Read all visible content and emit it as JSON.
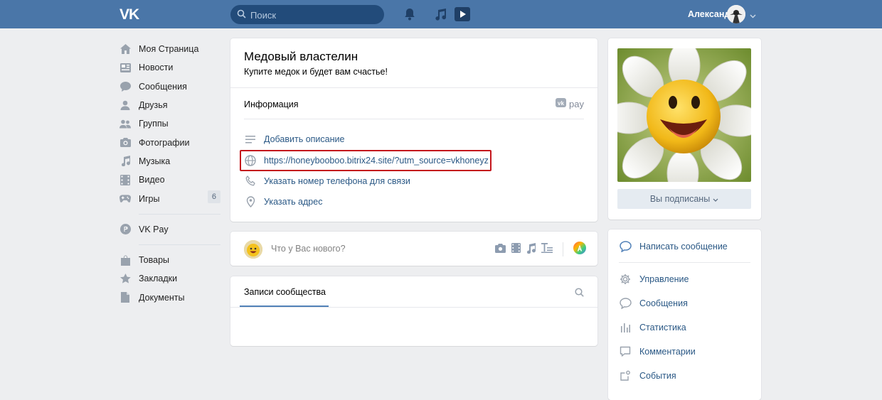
{
  "topbar": {
    "logo": "VK",
    "search_placeholder": "Поиск",
    "user_name": "Александр"
  },
  "leftnav": {
    "items": [
      {
        "label": "Моя Страница",
        "icon": "home-icon"
      },
      {
        "label": "Новости",
        "icon": "news-icon"
      },
      {
        "label": "Сообщения",
        "icon": "messages-icon"
      },
      {
        "label": "Друзья",
        "icon": "friends-icon"
      },
      {
        "label": "Группы",
        "icon": "groups-icon"
      },
      {
        "label": "Фотографии",
        "icon": "camera-icon"
      },
      {
        "label": "Музыка",
        "icon": "music-icon"
      },
      {
        "label": "Видео",
        "icon": "video-icon"
      },
      {
        "label": "Игры",
        "icon": "games-icon",
        "badge": "6"
      }
    ],
    "vkpay": "VK Pay",
    "extras": [
      {
        "label": "Товары",
        "icon": "bag-icon"
      },
      {
        "label": "Закладки",
        "icon": "star-icon"
      },
      {
        "label": "Документы",
        "icon": "document-icon"
      }
    ]
  },
  "group": {
    "title": "Медовый властелин",
    "status": "Купите медок и будет вам счастье!",
    "info_label": "Информация",
    "vkpay_label": "pay",
    "add_description": "Добавить описание",
    "website": "https://honeybooboo.bitrix24.site/?utm_source=vkhoneyz",
    "add_phone": "Указать номер телефона для связи",
    "add_address": "Указать адрес"
  },
  "composer": {
    "placeholder": "Что у Вас нового?"
  },
  "wall": {
    "tab": "Записи сообщества"
  },
  "sidebar": {
    "subscribed": "Вы подписаны",
    "write_message": "Написать сообщение",
    "items": [
      {
        "label": "Управление",
        "icon": "gear-icon"
      },
      {
        "label": "Сообщения",
        "icon": "messages-icon"
      },
      {
        "label": "Статистика",
        "icon": "stats-icon"
      },
      {
        "label": "Комментарии",
        "icon": "comments-icon"
      },
      {
        "label": "События",
        "icon": "events-icon"
      }
    ]
  },
  "colors": {
    "header": "#4a76a8",
    "link": "#2a5885",
    "background": "#edeef0",
    "highlight": "#c4161c"
  }
}
